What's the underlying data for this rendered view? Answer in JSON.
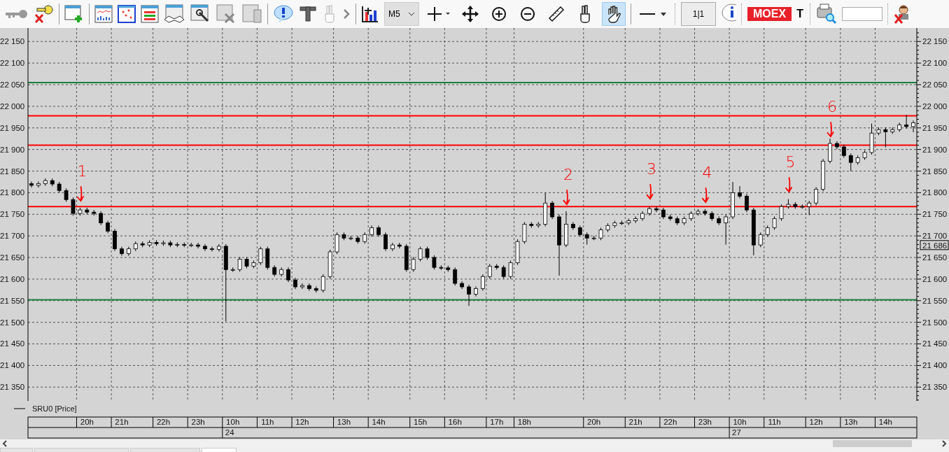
{
  "toolbar": {
    "interval": "M5",
    "cursor_tools": [
      {
        "selected": false
      },
      {
        "selected": false
      },
      {
        "selected": false
      },
      {
        "selected": false
      },
      {
        "selected": false
      },
      {
        "selected": false
      },
      {
        "selected": true
      }
    ],
    "ratio_button": "1|1",
    "exchange_badge": "MOEX",
    "cut_text": "Т"
  },
  "chart": {
    "chart_data": {
      "type": "candlestick",
      "grid": true,
      "ylim": [
        21318,
        22178
      ],
      "yticks": [
        {
          "value": 22150,
          "label": "22 150"
        },
        {
          "value": 22100,
          "label": "22 100"
        },
        {
          "value": 22050,
          "label": "22 050"
        },
        {
          "value": 22000,
          "label": "22 000"
        },
        {
          "value": 21950,
          "label": "21 950"
        },
        {
          "value": 21900,
          "label": "21 900"
        },
        {
          "value": 21850,
          "label": "21 850"
        },
        {
          "value": 21800,
          "label": "21 800"
        },
        {
          "value": 21750,
          "label": "21 750"
        },
        {
          "value": 21700,
          "label": "21 700"
        },
        {
          "value": 21650,
          "label": "21 650"
        },
        {
          "value": 21600,
          "label": "21 600"
        },
        {
          "value": 21550,
          "label": "21 550"
        },
        {
          "value": 21500,
          "label": "21 500"
        },
        {
          "value": 21450,
          "label": "21 450"
        },
        {
          "value": 21400,
          "label": "21 400"
        },
        {
          "value": 21350,
          "label": "21 350"
        }
      ],
      "categories": [
        null,
        null,
        null,
        null,
        null,
        null,
        null,
        null,
        "20h",
        null,
        null,
        null,
        null,
        "21h",
        null,
        null,
        null,
        null,
        null,
        "22h",
        null,
        null,
        null,
        null,
        "23h",
        null,
        null,
        null,
        null,
        "10h",
        null,
        null,
        null,
        null,
        "11h",
        null,
        null,
        null,
        null,
        "12h",
        null,
        null,
        null,
        null,
        null,
        "13h",
        null,
        null,
        null,
        null,
        "14h",
        null,
        null,
        null,
        null,
        null,
        "15h",
        null,
        null,
        null,
        null,
        "16h",
        null,
        null,
        null,
        null,
        null,
        "17h",
        null,
        null,
        null,
        "18h",
        null,
        null,
        null,
        null,
        null,
        null,
        null,
        null,
        null,
        "20h",
        null,
        null,
        null,
        null,
        null,
        "21h",
        null,
        null,
        null,
        null,
        "22h",
        null,
        null,
        null,
        null,
        "23h",
        null,
        null,
        null,
        null,
        "10h",
        null,
        null,
        null,
        null,
        "11h",
        null,
        null,
        null,
        null,
        null,
        "12h",
        null,
        null,
        null,
        null,
        "13h",
        null,
        null,
        null,
        null,
        "14h",
        null,
        null,
        null,
        null
      ],
      "series": [
        {
          "name": "SRU0 [Price]",
          "color": "#000000",
          "ohlc": [
            [
              21821,
              21826,
              21812,
              21817
            ],
            [
              21817,
              21826,
              21812,
              21821
            ],
            [
              21821,
              21833,
              21816,
              21828
            ],
            [
              21828,
              21833,
              21815,
              21820
            ],
            [
              21820,
              21825,
              21800,
              21805
            ],
            [
              21805,
              21810,
              21779,
              21784
            ],
            [
              21784,
              21789,
              21747,
              21752
            ],
            [
              21752,
              21765,
              21747,
              21760
            ],
            [
              21760,
              21765,
              21750,
              21755
            ],
            [
              21755,
              21760,
              21747,
              21752
            ],
            [
              21752,
              21757,
              21725,
              21730
            ],
            [
              21730,
              21735,
              21706,
              21711
            ],
            [
              21711,
              21716,
              21665,
              21670
            ],
            [
              21670,
              21675,
              21654,
              21659
            ],
            [
              21659,
              21675,
              21654,
              21670
            ],
            [
              21670,
              21687,
              21665,
              21682
            ],
            [
              21682,
              21687,
              21674,
              21679
            ],
            [
              21679,
              21690,
              21674,
              21685
            ],
            [
              21685,
              21690,
              21677,
              21682
            ],
            [
              21682,
              21689,
              21677,
              21684
            ],
            [
              21684,
              21689,
              21674,
              21679
            ],
            [
              21679,
              21685,
              21674,
              21680
            ],
            [
              21680,
              21685,
              21674,
              21679
            ],
            [
              21679,
              21684,
              21674,
              21679
            ],
            [
              21679,
              21684,
              21671,
              21676
            ],
            [
              21676,
              21681,
              21665,
              21670
            ],
            [
              21670,
              21675,
              21664,
              21669
            ],
            [
              21669,
              21681,
              21664,
              21676
            ],
            [
              21676,
              21681,
              21502,
              21622
            ],
            [
              21622,
              21627,
              21617,
              21622
            ],
            [
              21622,
              21651,
              21617,
              21646
            ],
            [
              21646,
              21651,
              21625,
              21630
            ],
            [
              21630,
              21643,
              21625,
              21638
            ],
            [
              21638,
              21675,
              21633,
              21670
            ],
            [
              21670,
              21675,
              21622,
              21627
            ],
            [
              21627,
              21632,
              21606,
              21611
            ],
            [
              21611,
              21627,
              21606,
              21622
            ],
            [
              21622,
              21627,
              21593,
              21598
            ],
            [
              21598,
              21603,
              21577,
              21582
            ],
            [
              21582,
              21590,
              21577,
              21585
            ],
            [
              21585,
              21590,
              21573,
              21578
            ],
            [
              21578,
              21583,
              21569,
              21574
            ],
            [
              21574,
              21611,
              21569,
              21606
            ],
            [
              21606,
              21668,
              21601,
              21663
            ],
            [
              21663,
              21708,
              21658,
              21703
            ],
            [
              21703,
              21708,
              21690,
              21695
            ],
            [
              21695,
              21700,
              21690,
              21695
            ],
            [
              21695,
              21700,
              21682,
              21687
            ],
            [
              21687,
              21708,
              21682,
              21703
            ],
            [
              21703,
              21724,
              21698,
              21719
            ],
            [
              21719,
              21724,
              21698,
              21703
            ],
            [
              21703,
              21708,
              21665,
              21670
            ],
            [
              21670,
              21684,
              21665,
              21679
            ],
            [
              21679,
              21684,
              21671,
              21676
            ],
            [
              21676,
              21681,
              21617,
              21622
            ],
            [
              21622,
              21651,
              21617,
              21646
            ],
            [
              21646,
              21675,
              21641,
              21670
            ],
            [
              21670,
              21675,
              21645,
              21650
            ],
            [
              21650,
              21655,
              21622,
              21627
            ],
            [
              21627,
              21632,
              21621,
              21626
            ],
            [
              21626,
              21631,
              21617,
              21622
            ],
            [
              21622,
              21627,
              21585,
              21590
            ],
            [
              21590,
              21595,
              21577,
              21582
            ],
            [
              21582,
              21587,
              21538,
              21565
            ],
            [
              21565,
              21583,
              21560,
              21578
            ],
            [
              21578,
              21611,
              21573,
              21606
            ],
            [
              21606,
              21635,
              21601,
              21630
            ],
            [
              21630,
              21635,
              21622,
              21627
            ],
            [
              21627,
              21632,
              21601,
              21606
            ],
            [
              21606,
              21643,
              21601,
              21638
            ],
            [
              21638,
              21692,
              21633,
              21687
            ],
            [
              21687,
              21732,
              21682,
              21727
            ],
            [
              21727,
              21732,
              21719,
              21724
            ],
            [
              21724,
              21732,
              21719,
              21727
            ],
            [
              21727,
              21800,
              21722,
              21776
            ],
            [
              21776,
              21781,
              21739,
              21744
            ],
            [
              21744,
              21749,
              21608,
              21679
            ],
            [
              21679,
              21757,
              21674,
              21727
            ],
            [
              21727,
              21732,
              21714,
              21719
            ],
            [
              21719,
              21724,
              21698,
              21703
            ],
            [
              21703,
              21708,
              21680,
              21695
            ],
            [
              21695,
              21700,
              21690,
              21695
            ],
            [
              21695,
              21719,
              21690,
              21714
            ],
            [
              21714,
              21729,
              21709,
              21724
            ],
            [
              21724,
              21735,
              21719,
              21730
            ],
            [
              21730,
              21735,
              21725,
              21730
            ],
            [
              21730,
              21740,
              21725,
              21735
            ],
            [
              21735,
              21745,
              21730,
              21740
            ],
            [
              21740,
              21757,
              21735,
              21752
            ],
            [
              21752,
              21768,
              21747,
              21763
            ],
            [
              21763,
              21768,
              21755,
              21760
            ],
            [
              21760,
              21765,
              21739,
              21744
            ],
            [
              21744,
              21749,
              21735,
              21740
            ],
            [
              21740,
              21745,
              21725,
              21730
            ],
            [
              21730,
              21745,
              21725,
              21740
            ],
            [
              21740,
              21757,
              21735,
              21752
            ],
            [
              21752,
              21762,
              21747,
              21757
            ],
            [
              21757,
              21762,
              21747,
              21752
            ],
            [
              21752,
              21757,
              21735,
              21740
            ],
            [
              21740,
              21745,
              21725,
              21730
            ],
            [
              21730,
              21749,
              21680,
              21744
            ],
            [
              21744,
              21825,
              21739,
              21800
            ],
            [
              21800,
              21815,
              21787,
              21792
            ],
            [
              21792,
              21797,
              21755,
              21760
            ],
            [
              21760,
              21765,
              21655,
              21679
            ],
            [
              21679,
              21708,
              21674,
              21703
            ],
            [
              21703,
              21724,
              21698,
              21719
            ],
            [
              21719,
              21745,
              21714,
              21740
            ],
            [
              21740,
              21773,
              21735,
              21768
            ],
            [
              21768,
              21785,
              21763,
              21773
            ],
            [
              21773,
              21778,
              21763,
              21768
            ],
            [
              21768,
              21773,
              21763,
              21768
            ],
            [
              21768,
              21781,
              21748,
              21776
            ],
            [
              21776,
              21813,
              21771,
              21808
            ],
            [
              21808,
              21878,
              21803,
              21873
            ],
            [
              21873,
              21925,
              21868,
              21914
            ],
            [
              21914,
              21919,
              21901,
              21906
            ],
            [
              21906,
              21911,
              21881,
              21886
            ],
            [
              21886,
              21891,
              21850,
              21870
            ],
            [
              21870,
              21886,
              21865,
              21881
            ],
            [
              21881,
              21898,
              21876,
              21893
            ],
            [
              21893,
              21960,
              21888,
              21938
            ],
            [
              21938,
              21951,
              21933,
              21946
            ],
            [
              21946,
              21951,
              21905,
              21941
            ],
            [
              21941,
              21951,
              21936,
              21946
            ],
            [
              21946,
              21962,
              21941,
              21957
            ],
            [
              21957,
              21980,
              21948,
              21953
            ],
            [
              21953,
              21967,
              21940,
              21962
            ]
          ]
        }
      ],
      "ref_lines": [
        {
          "axis": "y",
          "value": 22055,
          "color": "#1a7f3c"
        },
        {
          "axis": "y",
          "value": 21978,
          "color": "#ff0000"
        },
        {
          "axis": "y",
          "value": 21910,
          "color": "#ff0000"
        },
        {
          "axis": "y",
          "value": 21768,
          "color": "#ff0000"
        },
        {
          "axis": "y",
          "value": 21552,
          "color": "#1a7f3c"
        }
      ],
      "annotations": [
        {
          "text": "1"
        },
        {
          "text": "2"
        },
        {
          "text": "3"
        },
        {
          "text": "4"
        },
        {
          "text": "5"
        },
        {
          "text": "6"
        }
      ]
    },
    "price_marker": "21 686",
    "date_row": [
      {
        "label": "24"
      },
      {
        "label": "27"
      }
    ]
  },
  "bottom_tabs": [
    {
      "selected": false
    },
    {
      "selected": false
    },
    {
      "selected": false
    },
    {
      "selected": true
    }
  ]
}
